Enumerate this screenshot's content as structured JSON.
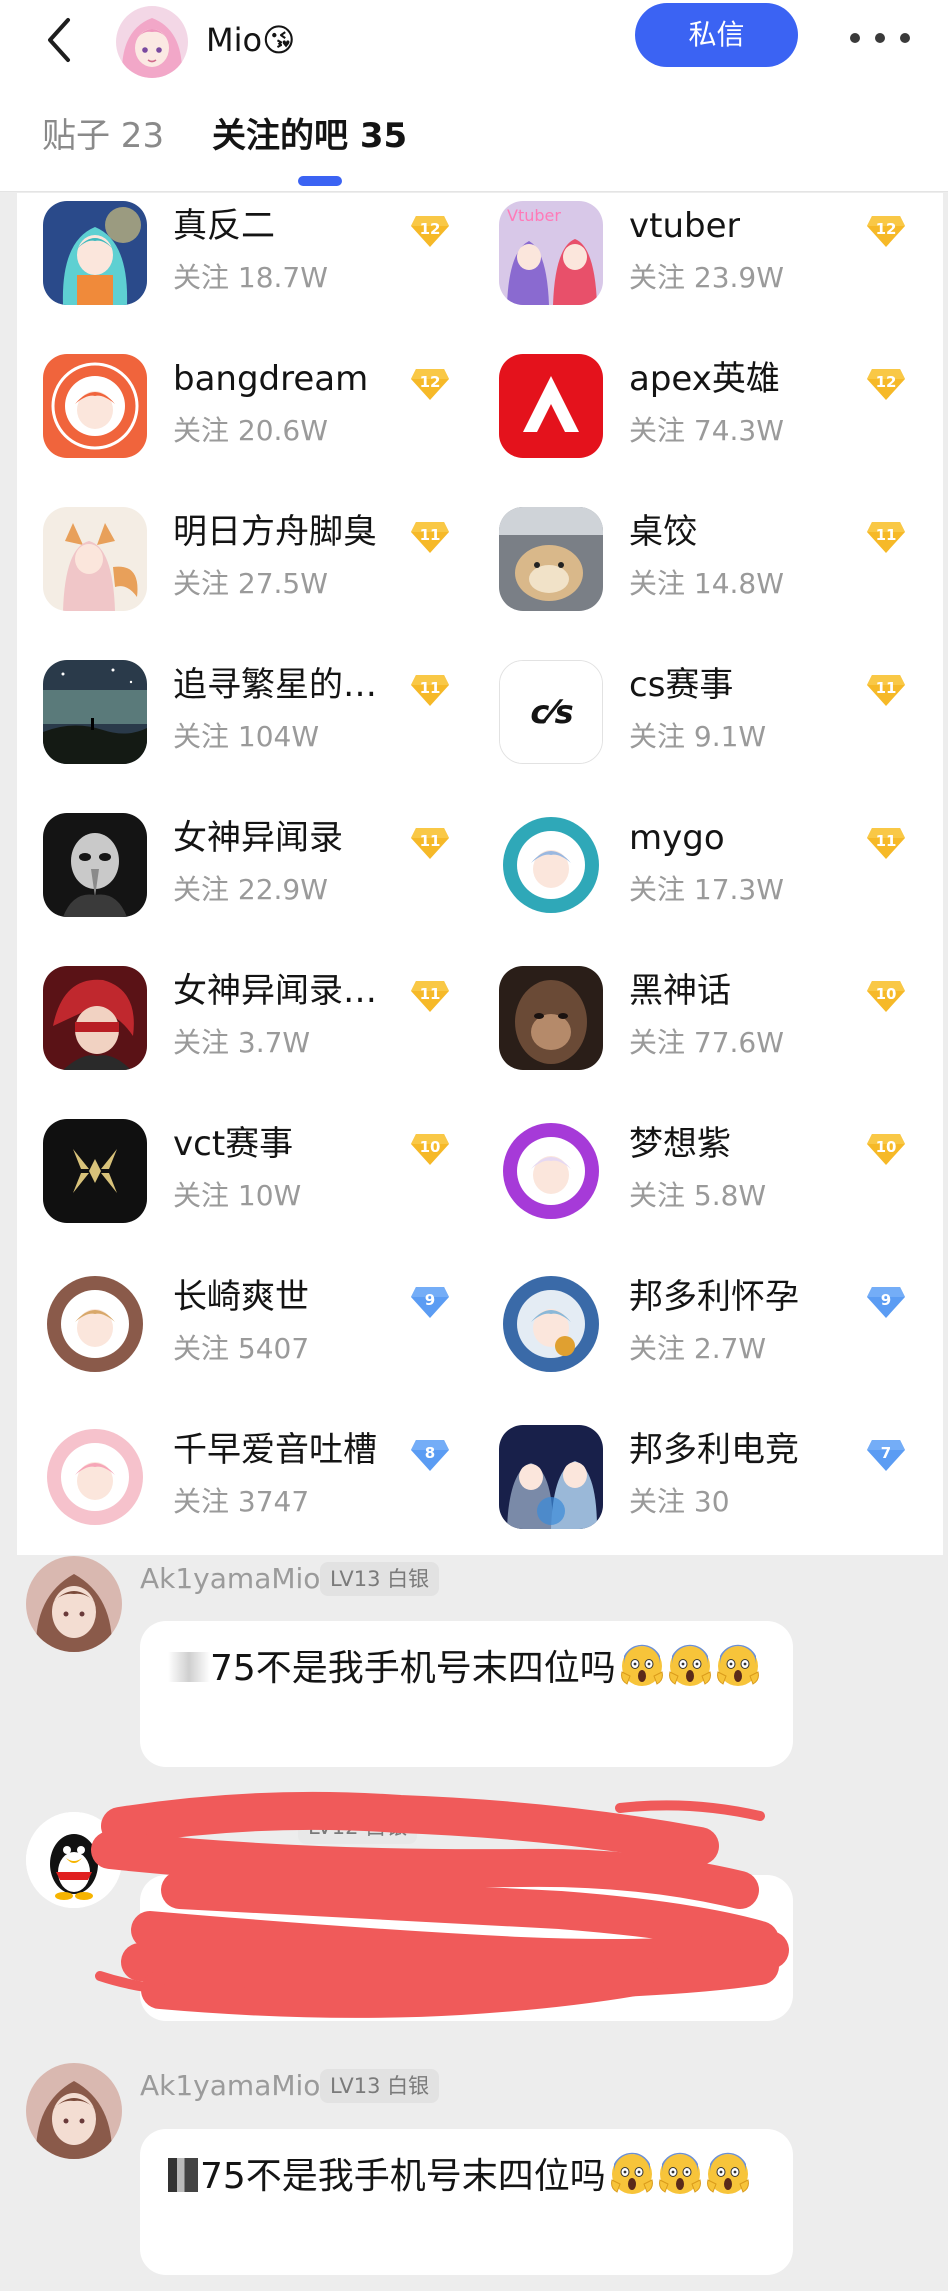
{
  "header": {
    "username": "Mio😘",
    "dm_button": "私信",
    "tabs": [
      {
        "label": "贴子 23",
        "active": false
      },
      {
        "label": "关注的吧 35",
        "active": true
      }
    ]
  },
  "forums": [
    {
      "name": "真反二",
      "followers": "关注 18.7W",
      "level": "12",
      "badge": "gold",
      "icon": "anime-girl-icon"
    },
    {
      "name": "vtuber",
      "followers": "关注 23.9W",
      "level": "12",
      "badge": "gold",
      "icon": "vtuber-icon"
    },
    {
      "name": "bangdream",
      "followers": "关注 20.6W",
      "level": "12",
      "badge": "gold",
      "icon": "bangdream-icon"
    },
    {
      "name": "apex英雄",
      "followers": "关注 74.3W",
      "level": "12",
      "badge": "gold",
      "icon": "apex-logo-icon"
    },
    {
      "name": "明日方舟脚臭",
      "followers": "关注 27.5W",
      "level": "11",
      "badge": "gold",
      "icon": "fox-girl-icon"
    },
    {
      "name": "桌饺",
      "followers": "关注 14.8W",
      "level": "11",
      "badge": "gold",
      "icon": "hamster-icon"
    },
    {
      "name": "追寻繁星的…",
      "followers": "关注 104W",
      "level": "11",
      "badge": "gold",
      "icon": "starry-night-icon"
    },
    {
      "name": "cs赛事",
      "followers": "关注 9.1W",
      "level": "11",
      "badge": "gold",
      "icon": "cs-logo-icon"
    },
    {
      "name": "女神异闻录",
      "followers": "关注 22.9W",
      "level": "11",
      "badge": "gold",
      "icon": "masked-character-icon"
    },
    {
      "name": "mygo",
      "followers": "关注 17.3W",
      "level": "11",
      "badge": "gold",
      "icon": "mygo-emblem-icon"
    },
    {
      "name": "女神异闻录…",
      "followers": "关注 3.7W",
      "level": "11",
      "badge": "gold",
      "icon": "red-hair-character-icon"
    },
    {
      "name": "黑神话",
      "followers": "关注 77.6W",
      "level": "10",
      "badge": "gold",
      "icon": "monkey-king-icon"
    },
    {
      "name": "vct赛事",
      "followers": "关注 10W",
      "level": "10",
      "badge": "gold",
      "icon": "vct-logo-icon"
    },
    {
      "name": "梦想紫",
      "followers": "关注 5.8W",
      "level": "10",
      "badge": "gold",
      "icon": "dream-purple-emblem-icon"
    },
    {
      "name": "长崎爽世",
      "followers": "关注 5407",
      "level": "9",
      "badge": "blue",
      "icon": "nagasaki-emblem-icon"
    },
    {
      "name": "邦多利怀孕",
      "followers": "关注 2.7W",
      "level": "9",
      "badge": "blue",
      "icon": "bang-dream-emblem-icon"
    },
    {
      "name": "千早爱音吐槽",
      "followers": "关注 3747",
      "level": "8",
      "badge": "blue",
      "icon": "pink-emblem-icon"
    },
    {
      "name": "邦多利电竞",
      "followers": "关注 30",
      "level": "7",
      "badge": "blue",
      "icon": "anime-duo-icon"
    }
  ],
  "badge_colors": {
    "gold": "#f6b928",
    "blue": "#5b9cf3"
  },
  "accent_color": "#3b63f3",
  "chat": {
    "msg1": {
      "name": "Ak1yamaMio",
      "level": "LV13 白银",
      "text": "75不是我手机号末四位吗"
    },
    "msg2": {
      "level": "LV12 白银"
    },
    "msg3": {
      "name": "Ak1yamaMio",
      "level": "LV13 白银",
      "text": "75不是我手机号末四位吗"
    }
  }
}
